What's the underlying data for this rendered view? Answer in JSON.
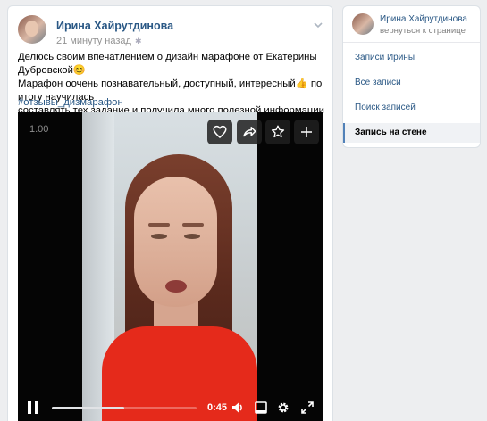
{
  "post": {
    "author": "Ирина Хайрутдинова",
    "time": "21 минуту назад",
    "text_lines": [
      "Делюсь своим впечатлением о дизайн марафоне от Екатерины Дубровской😊",
      "Марафон оочень познавательный, доступный, интересный👍 по итогу научилась",
      "составлять тех задание и получила много полезной информации"
    ],
    "hashtag": "#отзывы_дизмарафон"
  },
  "video": {
    "quality": "1.00",
    "current_time": "0:45",
    "progress": 0.5,
    "icons": [
      "heart-icon",
      "share-icon",
      "star-icon",
      "plus-icon",
      "pause-icon",
      "volume-icon",
      "miniplayer-icon",
      "settings-icon",
      "fullscreen-icon"
    ]
  },
  "sidebar": {
    "name": "Ирина Хайрутдинова",
    "back": "вернуться к странице",
    "items": [
      {
        "label": "Записи Ирины"
      },
      {
        "label": "Все записи"
      },
      {
        "label": "Поиск записей"
      },
      {
        "label": "Запись на стене"
      }
    ]
  },
  "colors": {
    "link": "#2a5885",
    "background": "#edeef0",
    "active_marker": "#5181b8"
  }
}
